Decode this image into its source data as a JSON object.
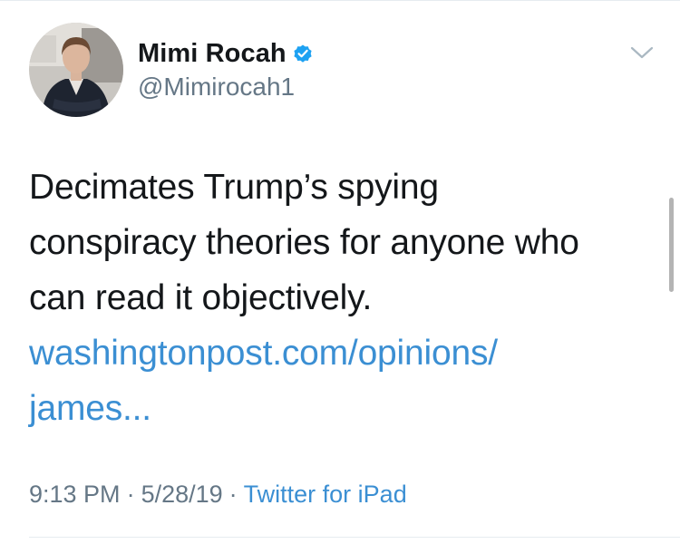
{
  "author": {
    "display_name": "Mimi Rocah",
    "handle": "@Mimirocah1",
    "verified": true,
    "avatar_icon": "profile-photo"
  },
  "tweet": {
    "text_lines": [
      "Decimates Trump’s spying",
      "conspiracy theories for anyone who",
      "can read it objectively."
    ],
    "link_lines": [
      "washingtonpost.com/opinions/",
      "james..."
    ]
  },
  "meta": {
    "time": "9:13 PM",
    "date": "5/28/19",
    "separator": "·",
    "source": "Twitter for iPad"
  },
  "icons": {
    "verified": "verified-badge-icon",
    "more": "chevron-down-icon"
  },
  "colors": {
    "link": "#3b8fd3",
    "secondary_text": "#657786",
    "verified": "#1da1f2"
  }
}
